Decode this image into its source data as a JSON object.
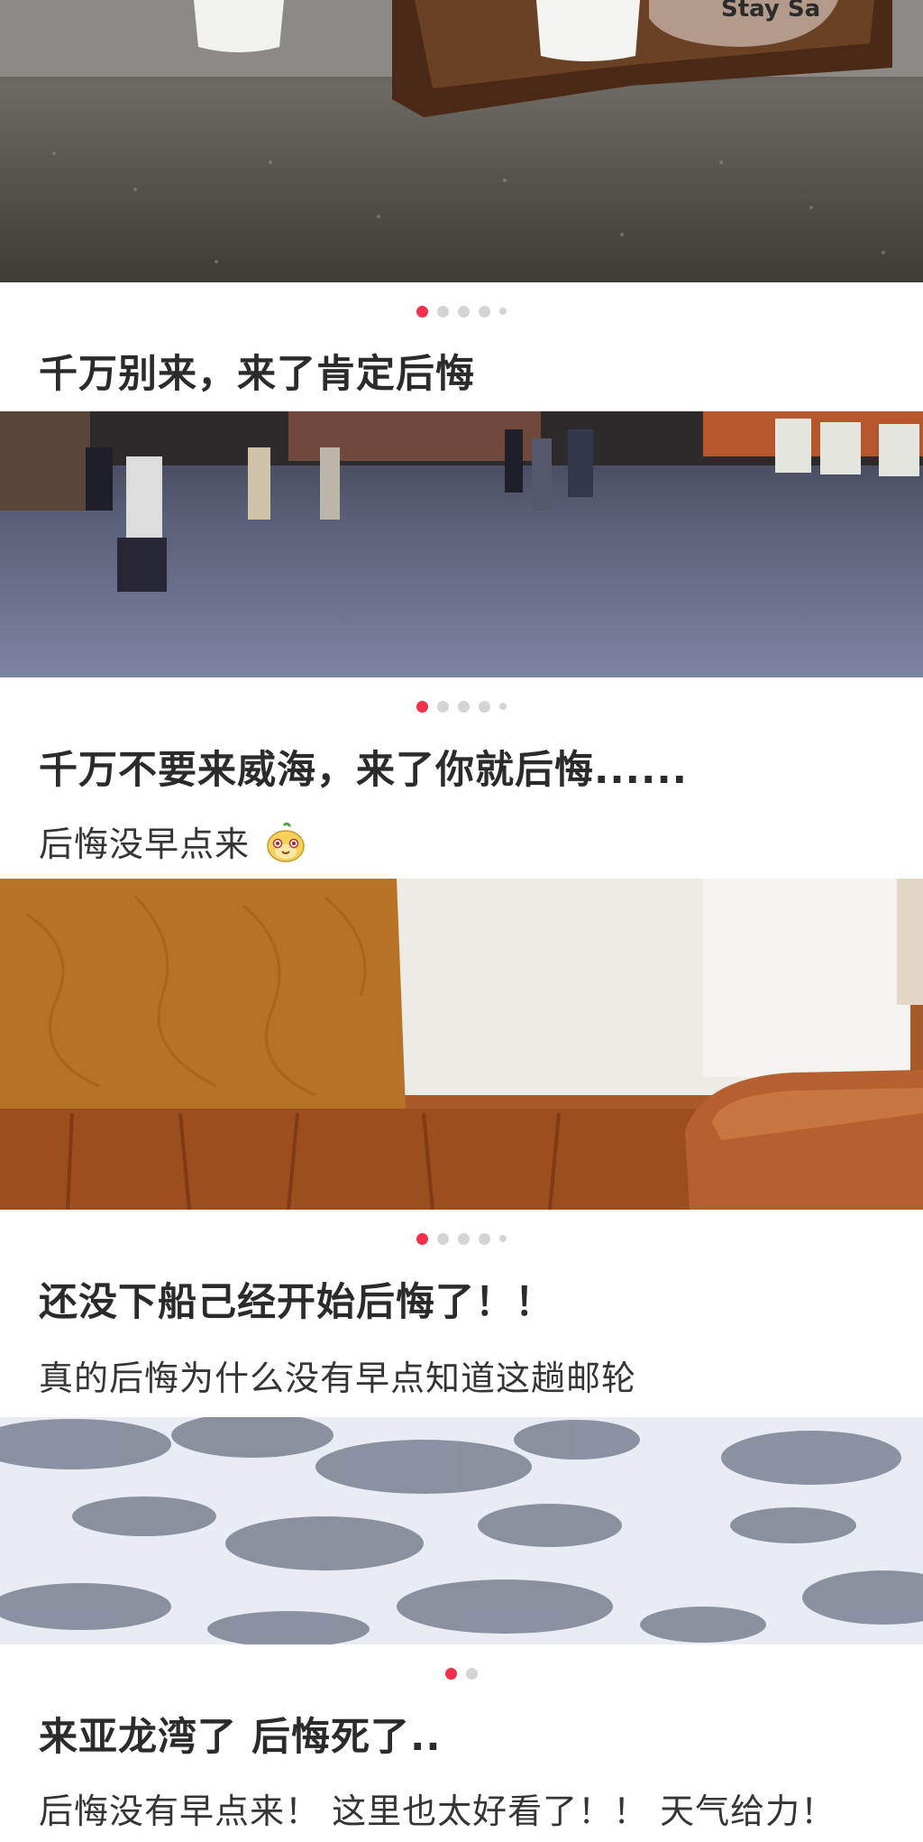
{
  "posts": [
    {
      "title": "千万别来，来了肯定后悔",
      "description": "",
      "image": "coffee-cups-on-wooden-tray",
      "carousel": {
        "count": 5,
        "active": 1
      }
    },
    {
      "title": "千万不要来威海，来了你就后悔......",
      "description": "后悔没早点来",
      "description_emoji": "smiling-face-emoji",
      "image": "night-street-pedestrians",
      "carousel": {
        "count": 5,
        "active": 1
      }
    },
    {
      "title": "还没下船己经开始后悔了！！",
      "description": "真的后悔为什么没有早点知道这趟邮轮",
      "image": "hotel-bed-with-orange-throw",
      "carousel": {
        "count": 5,
        "active": 1
      }
    },
    {
      "title": "来亚龙湾了 后悔死了..",
      "description": "后悔没有早点来！ 这里也太好看了！！ 天气给力！",
      "image": "sea-foam-beach",
      "carousel": {
        "count": 2,
        "active": 1
      }
    }
  ],
  "colors": {
    "active_dot": "#f2304b",
    "inactive_dot": "#d4d4d4",
    "title_text": "#2b2b2b"
  }
}
